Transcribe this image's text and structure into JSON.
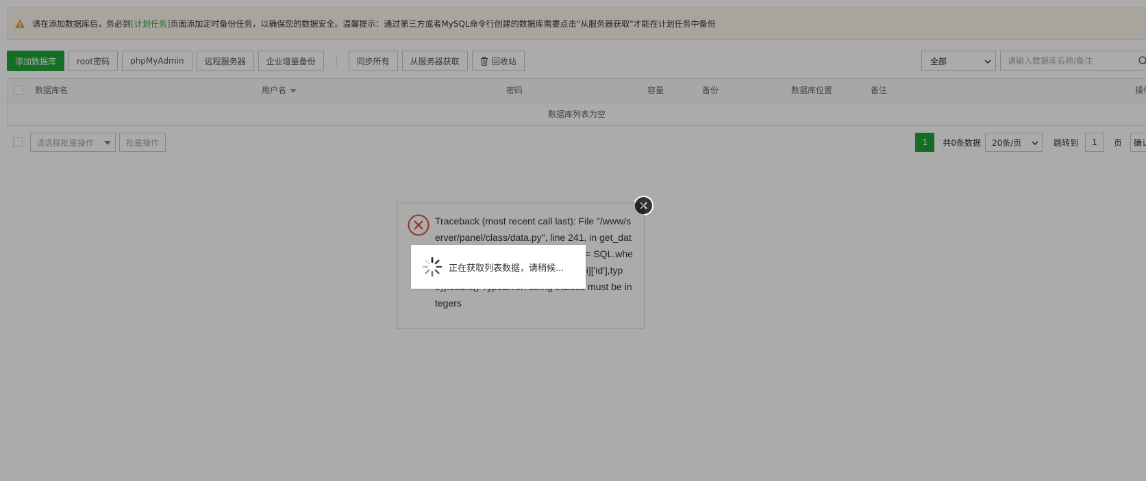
{
  "notice": {
    "text_before": "请在添加数据库后，务必到",
    "link": "[计划任务]",
    "text_after": "页面添加定时备份任务，以确保您的数据安全。温馨提示：通过第三方或者MySQL命令行创建的数据库需要点击\"从服务器获取\"才能在计划任务中备份"
  },
  "toolbar": {
    "add_db": "添加数据库",
    "root_password": "root密码",
    "phpmyadmin": "phpMyAdmin",
    "remote_server": "远程服务器",
    "incremental_backup": "企业增量备份",
    "sync_all": "同步所有",
    "fetch_from_server": "从服务器获取",
    "recycle_bin": "回收站"
  },
  "filter": {
    "selected": "全部"
  },
  "search": {
    "placeholder": "请输入数据库名称/备注"
  },
  "table": {
    "columns": [
      "数据库名",
      "用户名",
      "密码",
      "容量",
      "备份",
      "数据库位置",
      "备注",
      "操作"
    ],
    "empty_text": "数据库列表为空"
  },
  "footer": {
    "batch_placeholder": "请选择批量操作",
    "batch_button": "批量操作",
    "page_current": "1",
    "total": "共0条数据",
    "page_size": "20条/页",
    "jump_label": "跳转到",
    "jump_value": "1",
    "page_unit": "页",
    "confirm": "确认"
  },
  "error_dialog": {
    "message": "Traceback (most recent call last): File \"/www/server/panel/class/data.py\", line 241, in get_data_list data['data'][i]['backup_count'] = SQL.where(\"pid=? AND type=?\",(data['data'][i]['id'],type)).count() TypeError: string indices must be integers"
  },
  "loading": {
    "text": "正在获取列表数据，请稍候..."
  },
  "colors": {
    "brand_green": "#20a53a",
    "error_red": "#e0483f",
    "warning_orange": "#e6a23c"
  }
}
